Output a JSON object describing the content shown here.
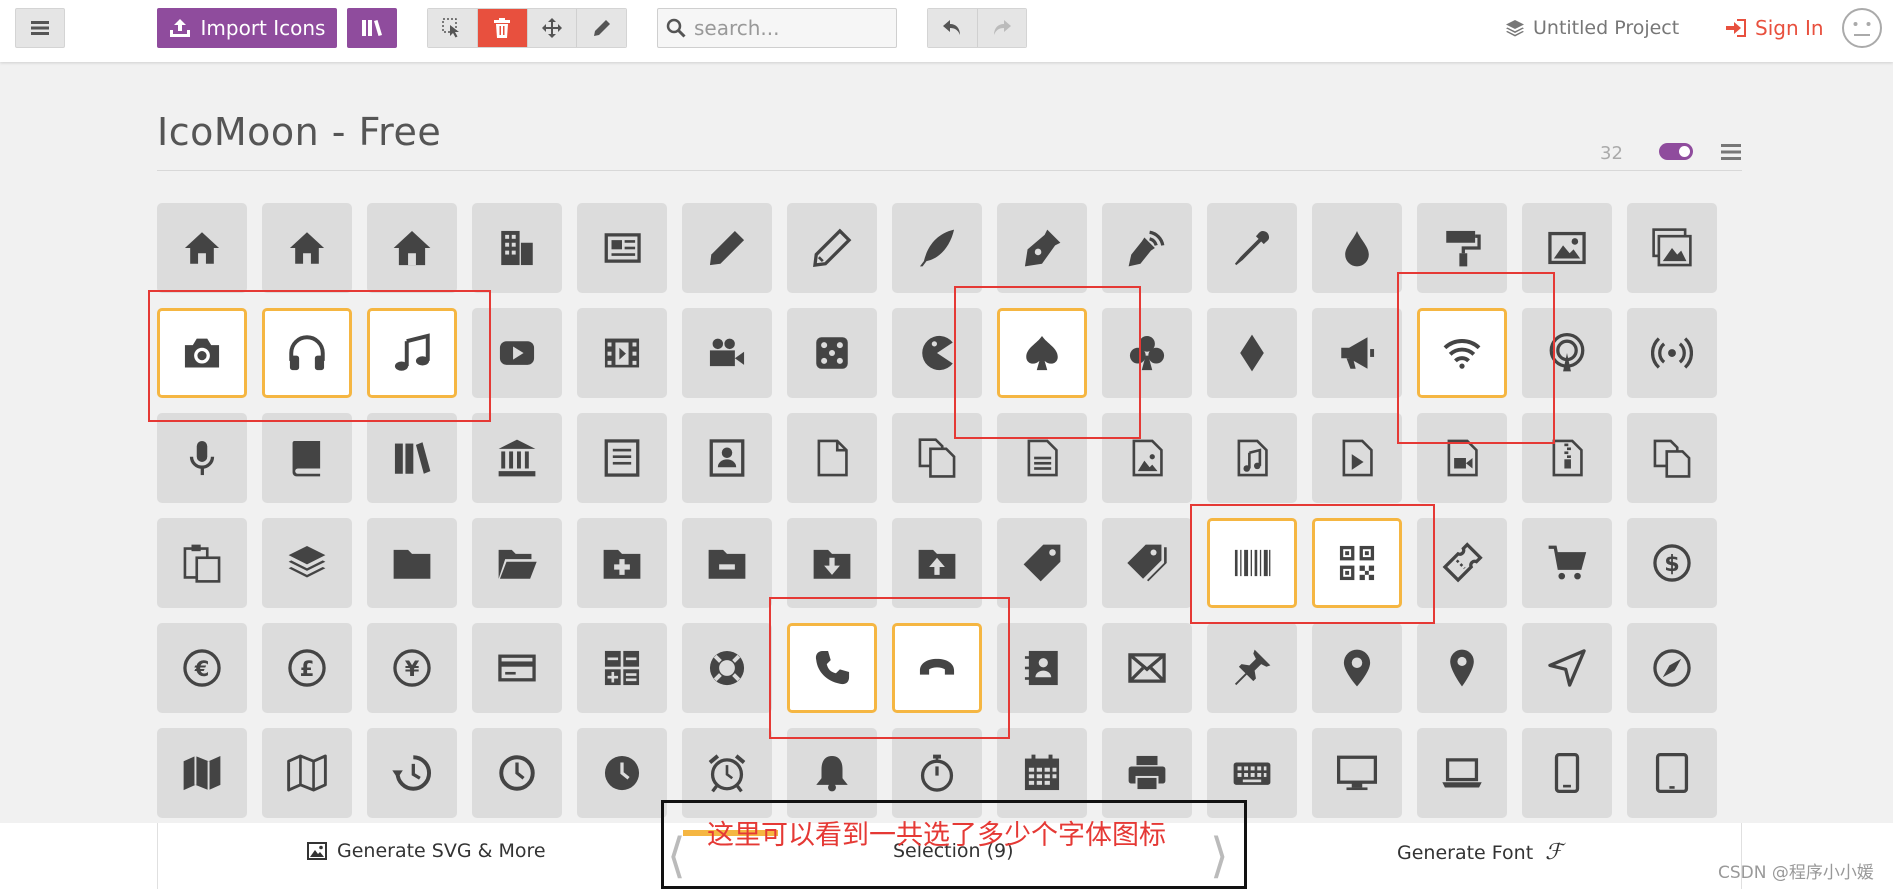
{
  "topbar": {
    "menu_icon": "hamburger-menu-icon",
    "import_label": "Import Icons",
    "search_placeholder": "search...",
    "project_name": "Untitled Project",
    "signin_label": "Sign In",
    "colors": {
      "purple": "#8f4c9d",
      "red": "#e8503e",
      "tool_bg": "#e5e5e5"
    }
  },
  "iconset": {
    "title": "IcoMoon - Free",
    "count": "32",
    "icons": [
      {
        "name": "home",
        "sel": false
      },
      {
        "name": "home2",
        "sel": false
      },
      {
        "name": "home3",
        "sel": false
      },
      {
        "name": "office",
        "sel": false
      },
      {
        "name": "newspaper",
        "sel": false
      },
      {
        "name": "pencil",
        "sel": false
      },
      {
        "name": "pencil2",
        "sel": false
      },
      {
        "name": "quill",
        "sel": false
      },
      {
        "name": "pen",
        "sel": false
      },
      {
        "name": "blog",
        "sel": false
      },
      {
        "name": "eyedropper",
        "sel": false
      },
      {
        "name": "droplet",
        "sel": false
      },
      {
        "name": "paint-format",
        "sel": false
      },
      {
        "name": "image",
        "sel": false
      },
      {
        "name": "images",
        "sel": false
      },
      {
        "name": "camera",
        "sel": true
      },
      {
        "name": "headphones",
        "sel": true
      },
      {
        "name": "music",
        "sel": true
      },
      {
        "name": "play",
        "sel": false
      },
      {
        "name": "film",
        "sel": false
      },
      {
        "name": "video-camera",
        "sel": false
      },
      {
        "name": "dice",
        "sel": false
      },
      {
        "name": "pacman",
        "sel": false
      },
      {
        "name": "spades",
        "sel": true
      },
      {
        "name": "clubs",
        "sel": false
      },
      {
        "name": "diamonds",
        "sel": false
      },
      {
        "name": "bullhorn",
        "sel": false
      },
      {
        "name": "connection",
        "sel": true
      },
      {
        "name": "podcast",
        "sel": false
      },
      {
        "name": "feed",
        "sel": false
      },
      {
        "name": "mic",
        "sel": false
      },
      {
        "name": "book",
        "sel": false
      },
      {
        "name": "books",
        "sel": false
      },
      {
        "name": "library",
        "sel": false
      },
      {
        "name": "file-text",
        "sel": false
      },
      {
        "name": "profile",
        "sel": false
      },
      {
        "name": "file-empty",
        "sel": false
      },
      {
        "name": "files-empty",
        "sel": false
      },
      {
        "name": "file-text2",
        "sel": false
      },
      {
        "name": "file-picture",
        "sel": false
      },
      {
        "name": "file-music",
        "sel": false
      },
      {
        "name": "file-play",
        "sel": false
      },
      {
        "name": "file-video",
        "sel": false
      },
      {
        "name": "file-zip",
        "sel": false
      },
      {
        "name": "copy",
        "sel": false
      },
      {
        "name": "paste",
        "sel": false
      },
      {
        "name": "stack",
        "sel": false
      },
      {
        "name": "folder",
        "sel": false
      },
      {
        "name": "folder-open",
        "sel": false
      },
      {
        "name": "folder-plus",
        "sel": false
      },
      {
        "name": "folder-minus",
        "sel": false
      },
      {
        "name": "folder-download",
        "sel": false
      },
      {
        "name": "folder-upload",
        "sel": false
      },
      {
        "name": "price-tag",
        "sel": false
      },
      {
        "name": "price-tags",
        "sel": false
      },
      {
        "name": "barcode",
        "sel": true
      },
      {
        "name": "qrcode",
        "sel": true
      },
      {
        "name": "ticket",
        "sel": false
      },
      {
        "name": "cart",
        "sel": false
      },
      {
        "name": "coin-dollar",
        "sel": false
      },
      {
        "name": "coin-euro",
        "sel": false
      },
      {
        "name": "coin-pound",
        "sel": false
      },
      {
        "name": "coin-yen",
        "sel": false
      },
      {
        "name": "credit-card",
        "sel": false
      },
      {
        "name": "calculator",
        "sel": false
      },
      {
        "name": "lifebuoy",
        "sel": false
      },
      {
        "name": "phone",
        "sel": true
      },
      {
        "name": "phone-hang-up",
        "sel": true
      },
      {
        "name": "address-book",
        "sel": false
      },
      {
        "name": "envelop",
        "sel": false
      },
      {
        "name": "pushpin",
        "sel": false
      },
      {
        "name": "location",
        "sel": false
      },
      {
        "name": "location2",
        "sel": false
      },
      {
        "name": "compass",
        "sel": false
      },
      {
        "name": "compass2",
        "sel": false
      },
      {
        "name": "map",
        "sel": false
      },
      {
        "name": "map2",
        "sel": false
      },
      {
        "name": "history",
        "sel": false
      },
      {
        "name": "clock",
        "sel": false
      },
      {
        "name": "clock2",
        "sel": false
      },
      {
        "name": "alarm",
        "sel": false
      },
      {
        "name": "bell",
        "sel": false
      },
      {
        "name": "stopwatch",
        "sel": false
      },
      {
        "name": "calendar",
        "sel": false
      },
      {
        "name": "printer",
        "sel": false
      },
      {
        "name": "keyboard",
        "sel": false
      },
      {
        "name": "display",
        "sel": false
      },
      {
        "name": "laptop",
        "sel": false
      },
      {
        "name": "mobile",
        "sel": false
      },
      {
        "name": "tablet",
        "sel": false
      }
    ]
  },
  "bottombar": {
    "generate_svg_label": "Generate SVG & More",
    "selection_label": "Selection (9)",
    "generate_font_label": "Generate Font",
    "generate_font_glyph": "ℱ"
  },
  "annotation": {
    "text": "这里可以看到一共选了多少个字体图标",
    "color": "#e53935"
  },
  "watermark": "CSDN @程序小小媛"
}
